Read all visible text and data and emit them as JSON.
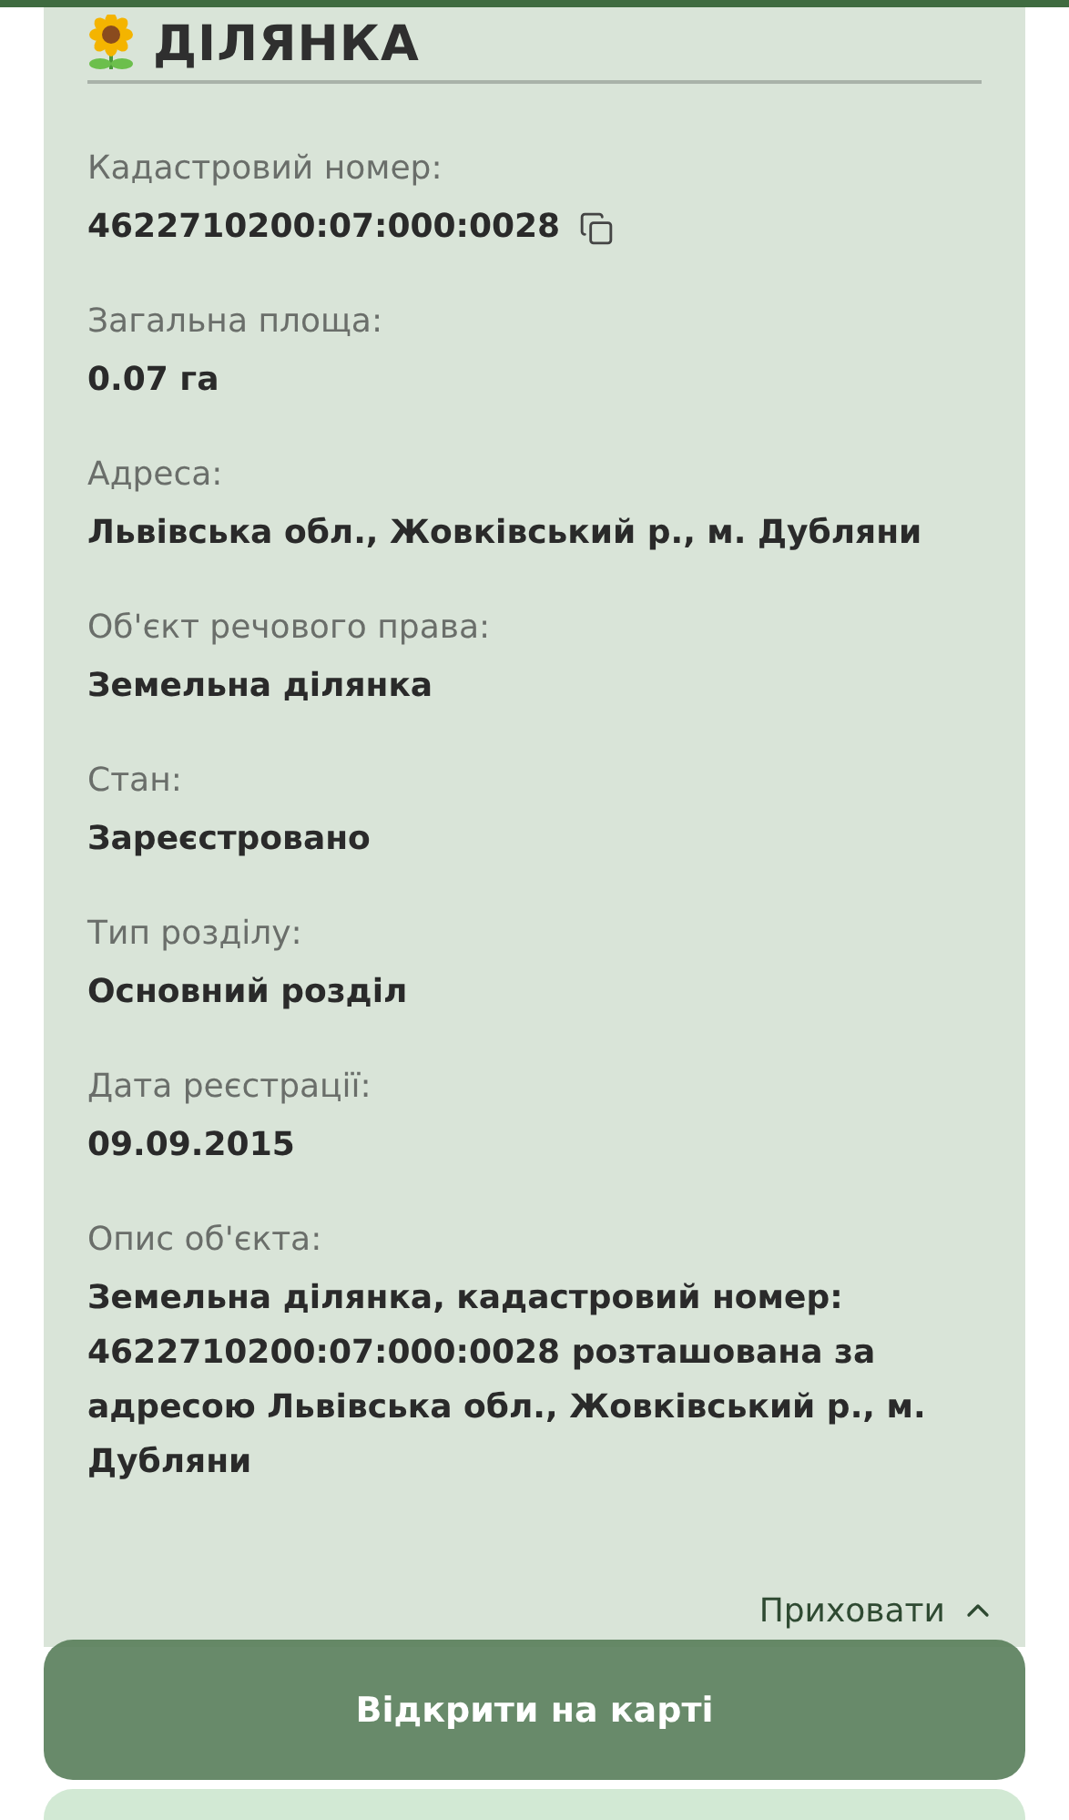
{
  "section": {
    "title": "ДІЛЯНКА"
  },
  "fields": [
    {
      "kind": "copyable",
      "label": "Кадастровий номер:",
      "value": "4622710200:07:000:0028"
    },
    {
      "kind": "text",
      "label": "Загальна площа:",
      "value": "0.07 га"
    },
    {
      "kind": "text",
      "label": "Адреса:",
      "value": "Львівська обл., Жовківський р., м. Дубляни"
    },
    {
      "kind": "text",
      "label": "Об'єкт речового права:",
      "value": "Земельна ділянка"
    },
    {
      "kind": "text",
      "label": "Стан:",
      "value": "Зареєстровано"
    },
    {
      "kind": "text",
      "label": "Тип розділу:",
      "value": "Основний розділ"
    },
    {
      "kind": "text",
      "label": "Дата реєстрації:",
      "value": "09.09.2015"
    },
    {
      "kind": "text",
      "label": "Опис об'єкта:",
      "value": "Земельна ділянка, кадастровий номер: 4622710200:07:000:0028 розташована за адресою Львівська обл., Жовківський р., м. Дубляни"
    }
  ],
  "hide_link": {
    "label": "Приховати"
  },
  "map_button": {
    "label": "Відкрити на карті"
  }
}
